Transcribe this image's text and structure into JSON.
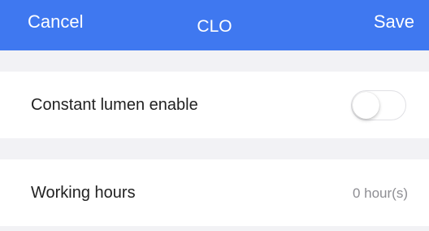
{
  "navbar": {
    "cancel_label": "Cancel",
    "title": "CLO",
    "save_label": "Save",
    "background_color": "#3f78f0"
  },
  "settings": {
    "constant_lumen": {
      "label": "Constant lumen enable",
      "enabled": false
    },
    "working_hours": {
      "label": "Working hours",
      "value": "0 hour(s)"
    }
  }
}
